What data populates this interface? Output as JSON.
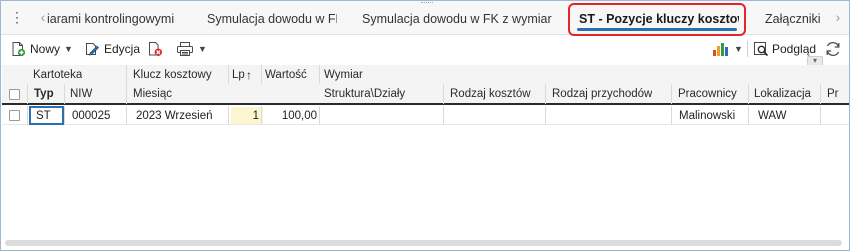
{
  "tabs": {
    "items": [
      {
        "label": "iarami kontrolingowymi"
      },
      {
        "label": "Symulacja dowodu w FK"
      },
      {
        "label": "Symulacja dowodu w FK z wymiarami"
      },
      {
        "label": "ST - Pozycje kluczy kosztowych"
      },
      {
        "label": "Załączniki"
      }
    ],
    "active_index": 3,
    "highlight_color": "#e0262a",
    "accent_color": "#2c6fb0"
  },
  "toolbar": {
    "new_label": "Nowy",
    "edit_label": "Edycja",
    "preview_label": "Podgląd",
    "icons": [
      "new-document-icon",
      "edit-icon",
      "delete-icon",
      "print-icon",
      "chart-icon",
      "preview-icon",
      "refresh-icon"
    ]
  },
  "grid": {
    "group_headers": {
      "kartoteka": "Kartoteka",
      "klucz": "Klucz kosztowy",
      "lp": "Lp",
      "wartosc": "Wartość",
      "wymiar": "Wymiar"
    },
    "columns": {
      "typ": "Typ",
      "niw": "NIW",
      "miesiac": "Miesiąc",
      "struktura": "Struktura\\Działy",
      "rodzaj_kosztow": "Rodzaj kosztów",
      "rodzaj_przychodow": "Rodzaj przychodów",
      "pracownicy": "Pracownicy",
      "lokalizacja": "Lokalizacja",
      "truncated": "Pr"
    },
    "rows": [
      {
        "typ": "ST",
        "niw": "000025",
        "miesiac": "2023 Wrzesień",
        "lp": "1",
        "wartosc": "100,00",
        "struktura": "",
        "rodzaj_kosztow": "",
        "rodzaj_przychodow": "",
        "pracownicy": "Malinowski",
        "lokalizacja": "WAW"
      }
    ],
    "sort_column": "Lp",
    "sort_direction": "ascending"
  }
}
